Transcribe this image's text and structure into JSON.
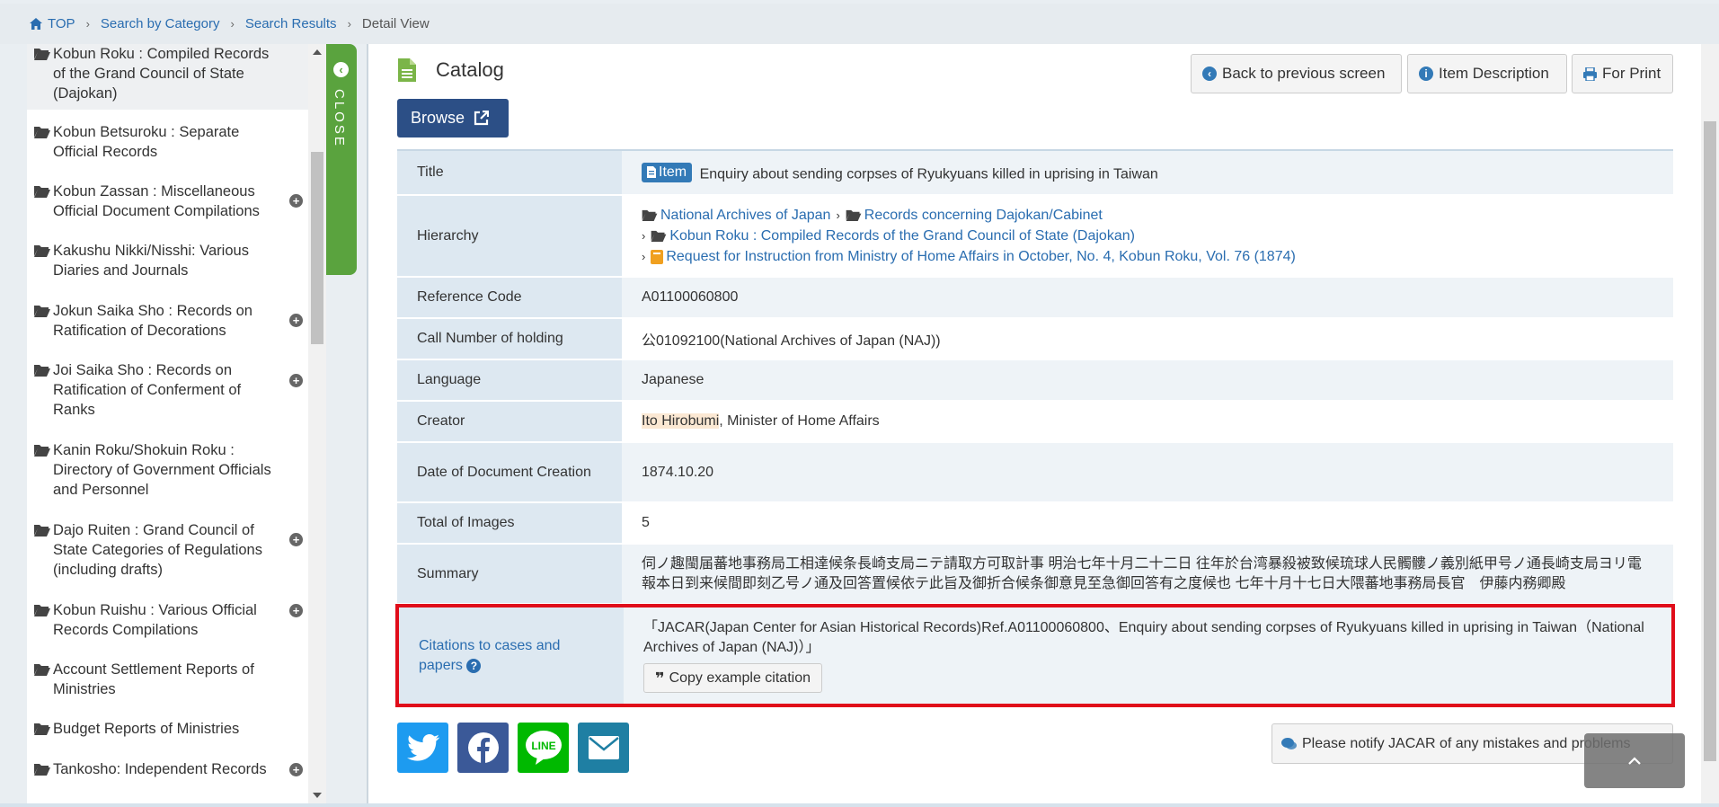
{
  "breadcrumb": {
    "items": [
      "TOP",
      "Search by Category",
      "Search Results"
    ],
    "current": "Detail View"
  },
  "sidebar": {
    "items": [
      {
        "label": "Kobun Roku : Compiled Records of the Grand Council of State (Dajokan)",
        "expandable": false
      },
      {
        "label": "Kobun Betsuroku : Separate Official Records",
        "expandable": false
      },
      {
        "label": "Kobun Zassan : Miscellaneous Official Document Compilations",
        "expandable": true
      },
      {
        "label": "Kakushu Nikki/Nisshi: Various Diaries and Journals",
        "expandable": false
      },
      {
        "label": "Jokun Saika Sho : Records on Ratification of Decorations",
        "expandable": true
      },
      {
        "label": "Joi Saika Sho : Records on Ratification of Conferment of Ranks",
        "expandable": true
      },
      {
        "label": "Kanin Roku/Shokuin Roku : Directory of Government Officials and Personnel",
        "expandable": false
      },
      {
        "label": "Dajo Ruiten : Grand Council of State Categories of Regulations (including drafts)",
        "expandable": true
      },
      {
        "label": "Kobun Ruishu : Various Official Records Compilations",
        "expandable": true
      },
      {
        "label": "Account Settlement Reports of Ministries",
        "expandable": false
      },
      {
        "label": "Budget Reports of Ministries",
        "expandable": false
      },
      {
        "label": "Tankosho: Independent Records",
        "expandable": true
      }
    ],
    "close_label": "CLOSE"
  },
  "main": {
    "heading": "Catalog",
    "browse_label": "Browse",
    "buttons": {
      "back": "Back to previous screen",
      "description": "Item Description",
      "print": "For Print"
    },
    "rows": {
      "title": {
        "label": "Title",
        "badge": "Item",
        "value": "Enquiry about sending corpses of Ryukyuans killed in uprising in Taiwan"
      },
      "hierarchy": {
        "label": "Hierarchy",
        "level1": "National Archives of Japan",
        "level2": "Records concerning Dajokan/Cabinet",
        "level3": "Kobun Roku : Compiled Records of the Grand Council of State (Dajokan)",
        "level4": "Request for Instruction from Ministry of Home Affairs in October, No. 4, Kobun Roku, Vol. 76 (1874)"
      },
      "reference": {
        "label": "Reference Code",
        "value": "A01100060800"
      },
      "callnumber": {
        "label": "Call Number of holding",
        "value": "公01092100(National Archives of Japan (NAJ))"
      },
      "language": {
        "label": "Language",
        "value": "Japanese"
      },
      "creator": {
        "label": "Creator",
        "name": "Ito Hirobumi",
        "rest": ", Minister of Home Affairs"
      },
      "date": {
        "label": "Date of Document Creation",
        "value": "1874.10.20"
      },
      "images": {
        "label": "Total of Images",
        "value": "5"
      },
      "summary": {
        "label": "Summary",
        "value": "伺ノ趣閩届蕃地事務局工相達候条長崎支局ニテ請取方可取計事 明治七年十月二十二日 往年於台湾暴殺被致候琉球人民髑髏ノ義別紙甲号ノ通長崎支局ヨリ電報本日到来候間即刻乙号ノ通及回答置候依テ此旨及御折合候条御意見至急御回答有之度候也 七年十月十七日大隈蕃地事務局長官　伊藤内務卿殿"
      }
    },
    "citation": {
      "label": "Citations to cases and papers",
      "value": "「JACAR(Japan Center for Asian Historical Records)Ref.A01100060800、Enquiry about sending corpses of Ryukyuans killed in uprising in Taiwan（National Archives of Japan (NAJ)）」",
      "copy_label": "Copy example citation"
    },
    "share": {
      "twitter_color": "#1d9bf0",
      "facebook_color": "#3b5998",
      "line_color": "#00b900",
      "mail_color": "#1f7fa3"
    },
    "notify_label": "Please notify JACAR of any mistakes and problems"
  }
}
